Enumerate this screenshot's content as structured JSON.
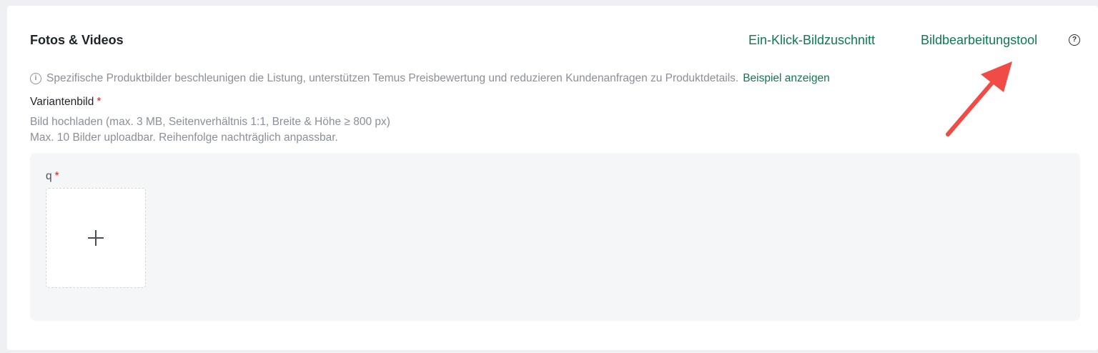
{
  "section": {
    "title": "Fotos & Videos",
    "crop_link": "Ein-Klick-Bildzuschnitt",
    "tool_link": "Bildbearbeitungstool",
    "help_icon": "?"
  },
  "info": {
    "icon": "i",
    "text": "Spezifische Produktbilder beschleunigen die Listung, unterstützen Temus Preisbewertung und reduzieren Kundenanfragen zu Produktdetails.",
    "example_link": "Beispiel anzeigen"
  },
  "variant": {
    "label": "Variantenbild",
    "required_mark": "*",
    "hint_line1": "Bild hochladen (max. 3 MB, Seitenverhältnis 1:1, Breite & Höhe ≥ 800 px)",
    "hint_line2": "Max. 10 Bilder uploadbar. Reihenfolge nachträglich anpassbar."
  },
  "upload": {
    "group_label": "q",
    "required_mark": "*",
    "add_icon": "plus-icon"
  },
  "annotation": {
    "arrow_color": "#f04b45"
  },
  "colors": {
    "accent": "#0c7b4f",
    "required": "#e02424",
    "muted_text": "#8a8f99"
  }
}
